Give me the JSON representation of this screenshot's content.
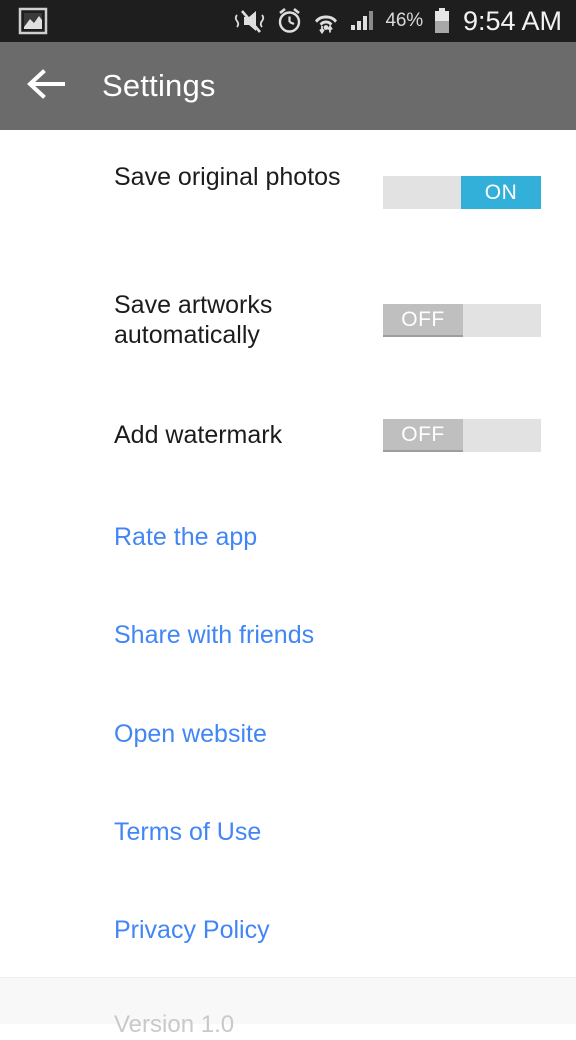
{
  "status_bar": {
    "left_icons": [
      {
        "name": "gallery-icon",
        "label": "Gallery"
      }
    ],
    "right_icons": [
      {
        "name": "vibrate-mute-icon",
        "label": "Sound off / vibrate"
      },
      {
        "name": "alarm-clock-icon",
        "label": "Alarm"
      },
      {
        "name": "wifi-data-icon",
        "label": "Wi-Fi with data transfer"
      },
      {
        "name": "cellular-signal-icon",
        "label": "Cellular signal"
      }
    ],
    "battery_percent": "46%",
    "battery_level": 46,
    "time": "9:54 AM",
    "background_color": "#1e1e1e",
    "text_color": "#f2f2f2"
  },
  "app_bar": {
    "back_icon": "arrow-left-icon",
    "title": "Settings",
    "background_color": "#6b6b6b",
    "text_color": "#ffffff"
  },
  "settings": [
    {
      "label": "Save original photos",
      "toggle_state": "ON",
      "state_on": true,
      "name": "save-original-photos"
    },
    {
      "label": "Save artworks automatically",
      "toggle_state": "OFF",
      "state_on": false,
      "name": "save-artworks-automatically"
    },
    {
      "label": "Add watermark",
      "toggle_state": "OFF",
      "state_on": false,
      "name": "add-watermark"
    }
  ],
  "links": [
    {
      "label": "Rate the app",
      "name": "rate-the-app"
    },
    {
      "label": "Share with friends",
      "name": "share-with-friends"
    },
    {
      "label": "Open website",
      "name": "open-website"
    },
    {
      "label": "Terms of Use",
      "name": "terms-of-use"
    },
    {
      "label": "Privacy Policy",
      "name": "privacy-policy"
    }
  ],
  "footer": {
    "version": "Version 1.0"
  },
  "colors": {
    "accent_blue": "#33b0da",
    "link_blue": "#4286f5",
    "toggle_track": "#e2e2e2",
    "toggle_thumb_off": "#bfbfbf",
    "app_bar": "#6b6b6b",
    "status_bar": "#1e1e1e"
  }
}
